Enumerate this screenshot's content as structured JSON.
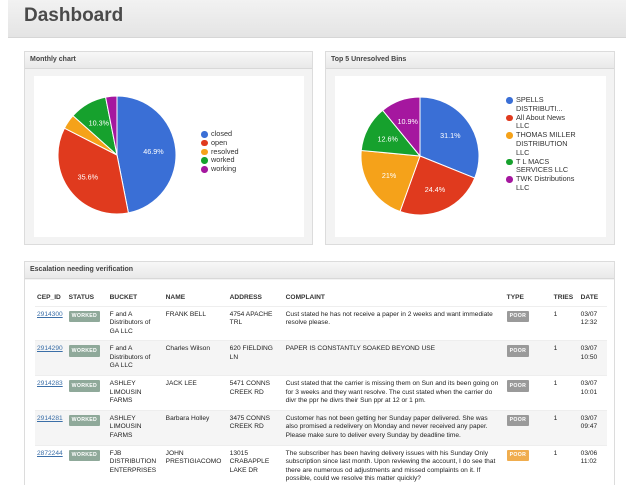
{
  "header": {
    "title": "Dashboard"
  },
  "monthly": {
    "title": "Monthly chart",
    "legend": [
      "closed",
      "open",
      "resolved",
      "worked",
      "working"
    ]
  },
  "bins": {
    "title": "Top 5 Unresolved Bins",
    "legend": [
      "SPELLS DISTRIBUTI...",
      "All About News LLC",
      "THOMAS MILLER DISTRIBUTION LLC",
      "T L MACS SERVICES LLC",
      "TWK Distributions LLC"
    ]
  },
  "chart_data": [
    {
      "type": "pie",
      "title": "Monthly chart",
      "categories": [
        "closed",
        "open",
        "resolved",
        "worked",
        "working"
      ],
      "values": [
        46.9,
        35.6,
        4.1,
        10.3,
        3.1
      ],
      "labels": [
        "46.9%",
        "35.6%",
        "",
        "10.3%",
        ""
      ],
      "colors": [
        "#3a6fd6",
        "#e03a1e",
        "#f5a21a",
        "#16a12d",
        "#a5179f"
      ]
    },
    {
      "type": "pie",
      "title": "Top 5 Unresolved Bins",
      "categories": [
        "SPELLS DISTRIBUTI...",
        "All About News LLC",
        "THOMAS MILLER DISTRIBUTION LLC",
        "T L MACS SERVICES LLC",
        "TWK Distributions LLC"
      ],
      "values": [
        31.1,
        24.4,
        21.0,
        12.6,
        10.9
      ],
      "labels": [
        "31.1%",
        "24.4%",
        "21%",
        "12.6%",
        "10.9%"
      ],
      "colors": [
        "#3a6fd6",
        "#e03a1e",
        "#f5a21a",
        "#16a12d",
        "#a5179f"
      ]
    }
  ],
  "escalation": {
    "title": "Escalation needing verification",
    "columns": [
      "CEP_ID",
      "STATUS",
      "BUCKET",
      "NAME",
      "ADDRESS",
      "COMPLAINT",
      "TYPE",
      "TRIES",
      "DATE"
    ],
    "rows": [
      {
        "cep_id": "2914300",
        "status": "WORKED",
        "bucket": "F and A Distributors of GA LLC",
        "name": "FRANK BELL",
        "address": "4754 APACHE TRL",
        "complaint": "Cust stated he has not receive a paper in 2 weeks and want immediate resolve please.",
        "type": "POOR",
        "type_color": "gray",
        "tries": "1",
        "date": "03/07 12:32"
      },
      {
        "cep_id": "2914290",
        "status": "WORKED",
        "bucket": "F and A Distributors of GA LLC",
        "name": "Charles Wilson",
        "address": "620 FIELDING LN",
        "complaint": "PAPER IS CONSTANTLY SOAKED BEYOND USE",
        "type": "POOR",
        "type_color": "gray",
        "tries": "1",
        "date": "03/07 10:50"
      },
      {
        "cep_id": "2914283",
        "status": "WORKED",
        "bucket": "ASHLEY LIMOUSIN FARMS",
        "name": "JACK LEE",
        "address": "5471 CONNS CREEK RD",
        "complaint": "Cust stated that the carrier is missing them on Sun and its been going on for 3 weeks and they want resolve. The cust stated when the carrier do divr the ppr he divrs their Sun ppr at 12 or 1 pm.",
        "type": "POOR",
        "type_color": "gray",
        "tries": "1",
        "date": "03/07 10:01"
      },
      {
        "cep_id": "2914281",
        "status": "WORKED",
        "bucket": "ASHLEY LIMOUSIN FARMS",
        "name": "Barbara Holley",
        "address": "3475 CONNS CREEK RD",
        "complaint": "Customer has not been getting her Sunday paper delivered. She was also promised a redelivery on Monday and never received any paper. Please make sure to deliver every Sunday by deadline time.",
        "type": "POOR",
        "type_color": "gray",
        "tries": "1",
        "date": "03/07 09:47"
      },
      {
        "cep_id": "2872244",
        "status": "WORKED",
        "bucket": "FJB DISTRIBUTION ENTERPRISES",
        "name": "JOHN PRESTIGIACOMO",
        "address": "13015 CRABAPPLE LAKE DR",
        "complaint": "The subscriber has been having delivery issues with his Sunday Only subscription since last month. Upon reviewing the account, I do see that there are numerous od adjustments and missed complaints on it. If possible, could we resolve this matter quickly?",
        "type": "POOR",
        "type_color": "orange",
        "tries": "1",
        "date": "03/06 11:02"
      }
    ]
  }
}
